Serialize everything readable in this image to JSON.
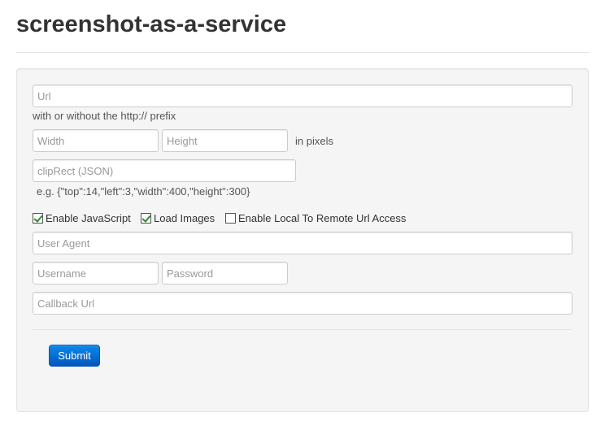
{
  "header": {
    "title": "screenshot-as-a-service"
  },
  "form": {
    "url": {
      "placeholder": "Url",
      "value": "",
      "help": "with or without the http:// prefix"
    },
    "width": {
      "placeholder": "Width",
      "value": ""
    },
    "height": {
      "placeholder": "Height",
      "value": ""
    },
    "dimensions_help": "in pixels",
    "clip_rect": {
      "placeholder": "clipRect (JSON)",
      "value": "",
      "help": "e.g. {\"top\":14,\"left\":3,\"width\":400,\"height\":300}"
    },
    "checkboxes": [
      {
        "label": "Enable JavaScript",
        "checked": true
      },
      {
        "label": "Load Images",
        "checked": true
      },
      {
        "label": "Enable Local To Remote Url Access",
        "checked": false
      }
    ],
    "user_agent": {
      "placeholder": "User Agent",
      "value": ""
    },
    "username": {
      "placeholder": "Username",
      "value": ""
    },
    "password": {
      "placeholder": "Password",
      "value": ""
    },
    "callback_url": {
      "placeholder": "Callback Url",
      "value": ""
    },
    "submit_label": "Submit"
  },
  "colors": {
    "submit_gradient_top": "#0a8ae8",
    "submit_gradient_bottom": "#0455c0",
    "well_background": "#f5f5f5",
    "check_mark": "#2a8a2a"
  },
  "icons": {
    "checkbox_checked": "check-mark-icon"
  }
}
